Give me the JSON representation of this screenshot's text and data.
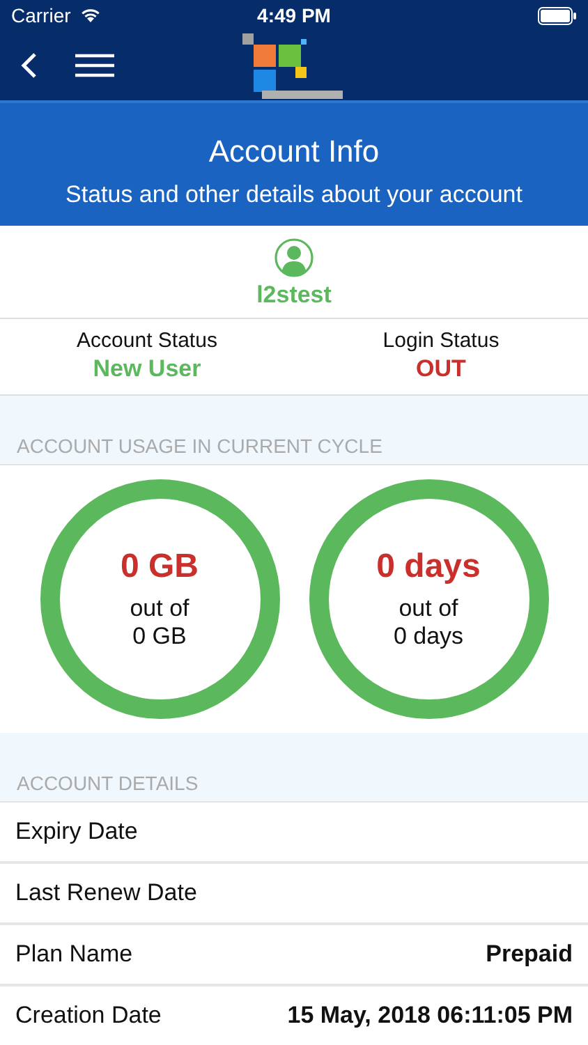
{
  "status_bar": {
    "carrier": "Carrier",
    "time": "4:49 PM"
  },
  "header": {
    "title": "Account Info",
    "subtitle": "Status and other details about your account"
  },
  "user": {
    "name": "l2stest"
  },
  "statuses": [
    {
      "label": "Account Status",
      "value": "New User",
      "color": "#5cb85c"
    },
    {
      "label": "Login Status",
      "value": "OUT",
      "color": "#c9302c"
    }
  ],
  "usage": {
    "heading": "ACCOUNT USAGE IN CURRENT CYCLE",
    "meters": [
      {
        "used": "0 GB",
        "out_of": "out of",
        "total": "0 GB"
      },
      {
        "used": "0 days",
        "out_of": "out of",
        "total": "0 days"
      }
    ]
  },
  "details": {
    "heading": "ACCOUNT DETAILS",
    "rows": [
      {
        "label": "Expiry Date"
      },
      {
        "label": "Last Renew Date"
      },
      {
        "label": "Plan Name",
        "value": "Prepaid"
      },
      {
        "label": "Creation Date",
        "value": "15 May, 2018 06:11:05 PM"
      }
    ]
  }
}
